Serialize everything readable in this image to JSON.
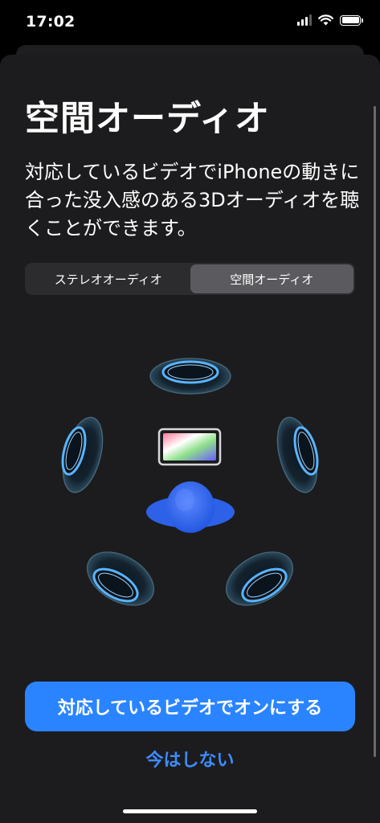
{
  "status_bar": {
    "time": "17:02",
    "icons": [
      "cellular-signal-icon",
      "wifi-icon",
      "battery-icon"
    ]
  },
  "sheet": {
    "title": "空間オーディオ",
    "description": "対応しているビデオでiPhoneの動きに合った没入感のある3Dオーディオを聴くことができます。"
  },
  "segmented_control": {
    "options": [
      "ステレオオーディオ",
      "空間オーディオ"
    ],
    "selected_index": 1
  },
  "illustration": {
    "icons": [
      "speaker-ring-icon",
      "ipad-icon",
      "listener-head-icon"
    ]
  },
  "actions": {
    "primary_label": "対応しているビデオでオンにする",
    "secondary_label": "今はしない"
  },
  "colors": {
    "accent": "#2a84ff",
    "link": "#3d8cff",
    "sheet_background": "#1c1c1e",
    "segment_selected": "#5b5b5f",
    "ring_glow": "#5ab4ff"
  }
}
